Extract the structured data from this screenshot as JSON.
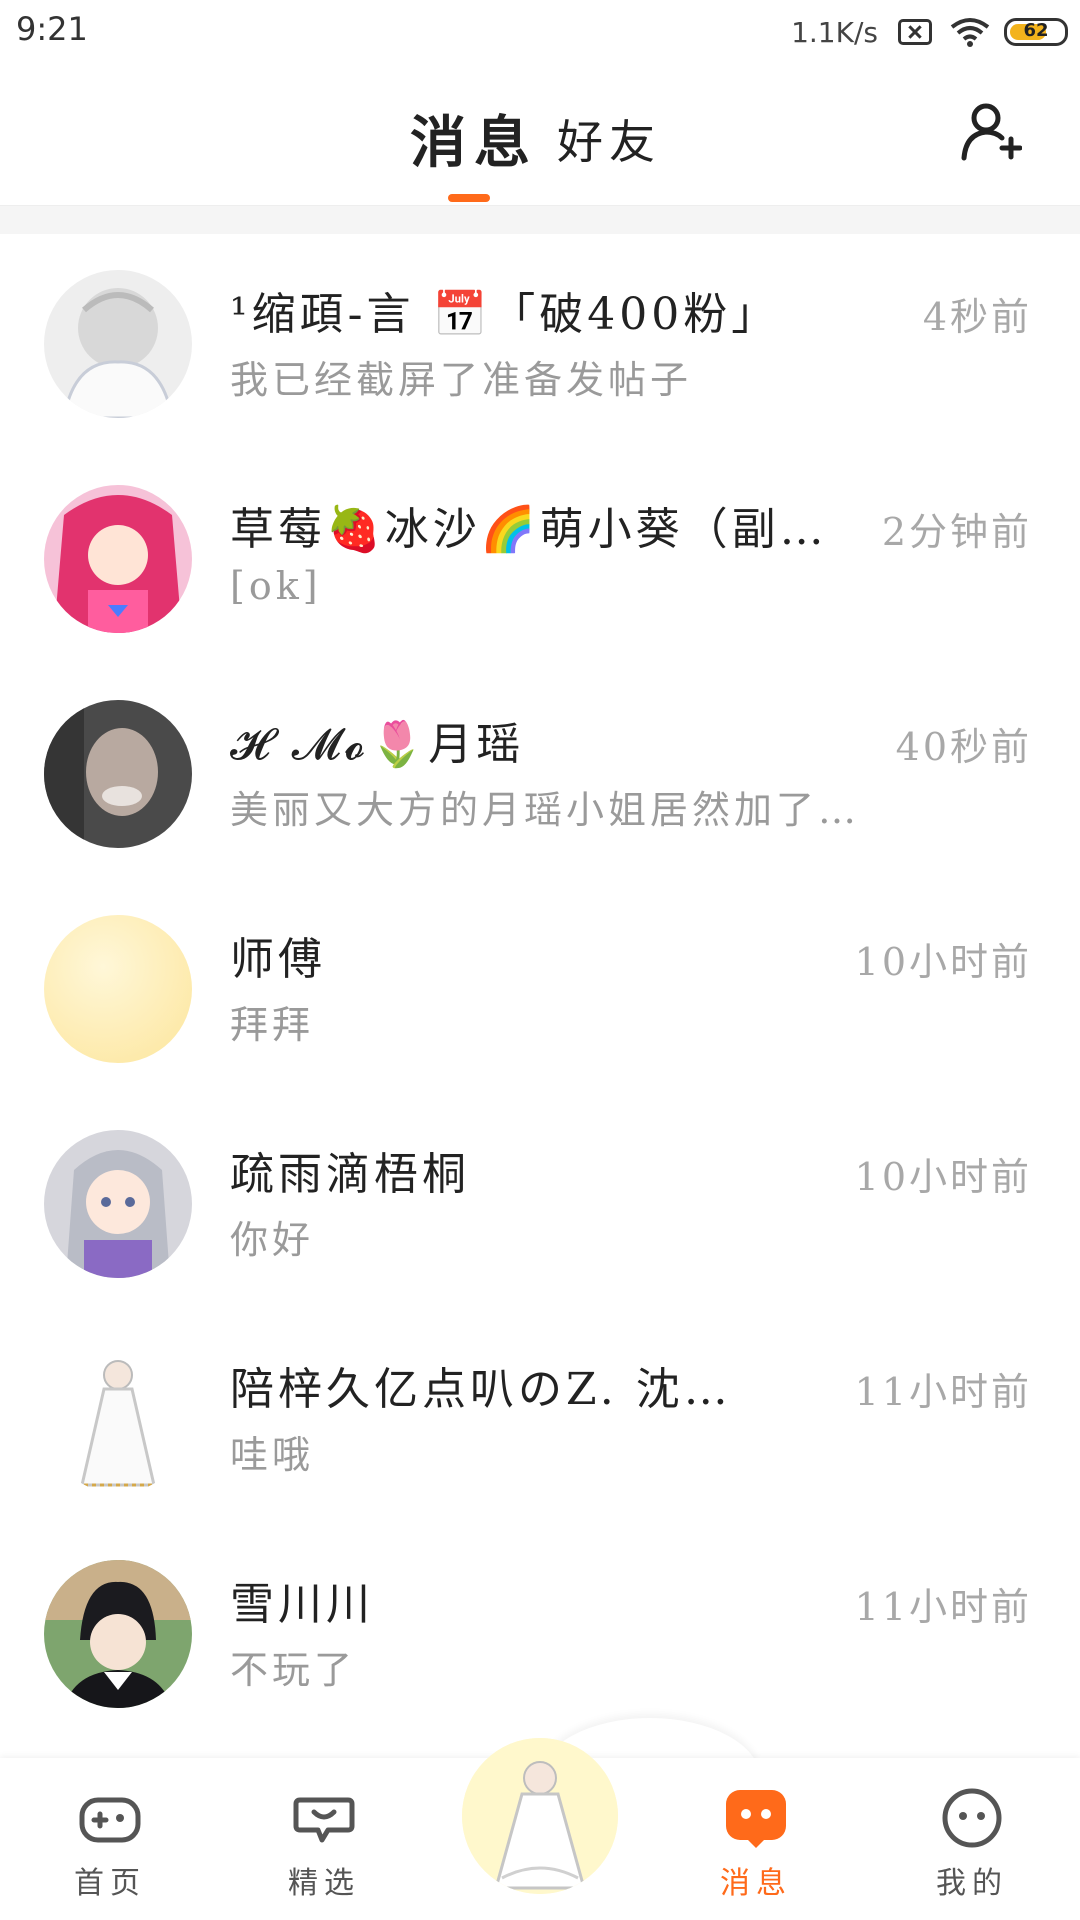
{
  "status_bar": {
    "time": "9:21",
    "net_speed": "1.1K/s",
    "battery": "62",
    "colors": {
      "battery": "#f3b31c"
    }
  },
  "header": {
    "tabs": [
      "消息",
      "好友"
    ],
    "active_tab": "消息",
    "accent_color": "#ff6a1a",
    "add_friend_icon": "add-user-icon"
  },
  "messages": [
    {
      "name": "¹缩頙-言 📅「破400粉」",
      "preview": "我已经截屏了准备发帖子",
      "time": "4秒前",
      "avatar": "white-hair-girl"
    },
    {
      "name": "草莓🍓冰沙🌈萌小葵（副…",
      "preview": "[ok]",
      "time": "2分钟前",
      "avatar": "pink-hair-girl"
    },
    {
      "name": "𝓗 𝓜𝓸🌷月瑶",
      "preview": "美丽又大方的月瑶小姐居然加了…",
      "time": "40秒前",
      "avatar": "blurred-photo"
    },
    {
      "name": "师傅",
      "preview": "拜拜",
      "time": "10小时前",
      "avatar": "yellow-gradient"
    },
    {
      "name": "疏雨滴梧桐",
      "preview": "你好",
      "time": "10小时前",
      "avatar": "silver-hair-girl"
    },
    {
      "name": "陪梓久亿点叭のZ. 沈…",
      "preview": "哇哦",
      "time": "11小时前",
      "avatar": "white-dress-girl"
    },
    {
      "name": "雪川川",
      "preview": "不玩了",
      "time": "11小时前",
      "avatar": "black-hair-boy"
    }
  ],
  "bottom_nav": {
    "items": [
      {
        "label": "首页",
        "icon": "gamepad-icon"
      },
      {
        "label": "精选",
        "icon": "heart-chat-icon"
      },
      {
        "label": "消息",
        "icon": "message-icon",
        "active": true
      },
      {
        "label": "我的",
        "icon": "face-icon"
      }
    ],
    "center_icon": "avatar-button"
  }
}
